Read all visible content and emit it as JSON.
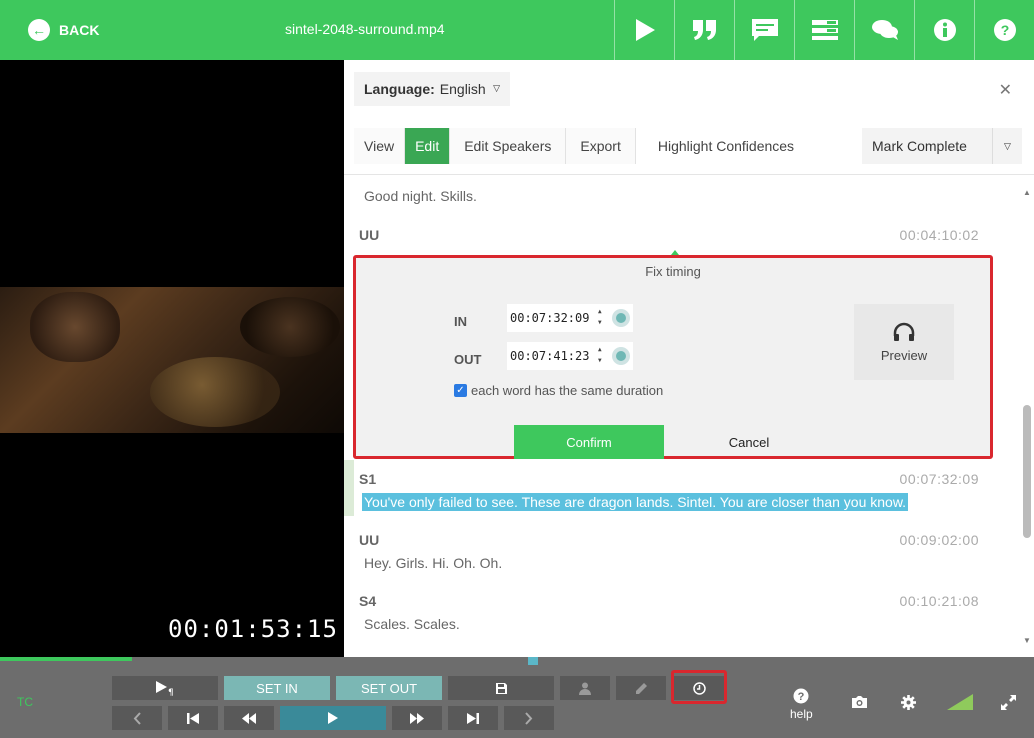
{
  "topbar": {
    "back_label": "BACK",
    "filename": "sintel-2048-surround.mp4",
    "icons": [
      "play-icon",
      "quote-icon",
      "subtitle-icon",
      "list-icon",
      "comments-icon",
      "info-icon",
      "help-icon"
    ]
  },
  "video": {
    "timecode": "00:01:53:15"
  },
  "panel": {
    "language_label": "Language:",
    "language_value": "English",
    "tabs": {
      "view": "View",
      "edit": "Edit",
      "edit_speakers": "Edit Speakers",
      "export": "Export",
      "highlight": "Highlight Confidences"
    },
    "mark_complete": "Mark Complete"
  },
  "transcript": [
    {
      "speaker": "",
      "time": "",
      "text": "Good night. Skills."
    },
    {
      "speaker": "UU",
      "time": "00:04:10:02",
      "text": ""
    },
    {
      "speaker": "S1",
      "time": "00:07:32:09",
      "text": "You've only failed to see. These are dragon lands. Sintel. You are closer than you know."
    },
    {
      "speaker": "UU",
      "time": "00:09:02:00",
      "text": "Hey. Girls. Hi. Oh. Oh."
    },
    {
      "speaker": "S4",
      "time": "00:10:21:08",
      "text": "Scales. Scales."
    }
  ],
  "fix_timing": {
    "title": "Fix timing",
    "in_label": "IN",
    "in_value": "00:07:32:09",
    "out_label": "OUT",
    "out_value": "00:07:41:23",
    "checkbox_label": "each word has the same duration",
    "preview_label": "Preview",
    "confirm_label": "Confirm",
    "cancel_label": "Cancel"
  },
  "controls": {
    "tc_label": "TC",
    "set_in": "SET IN",
    "set_out": "SET OUT",
    "help_label": "help"
  },
  "colors": {
    "brand_green": "#3ec85d",
    "highlight_blue": "#5bc0de",
    "annotation_red": "#d9272e"
  }
}
